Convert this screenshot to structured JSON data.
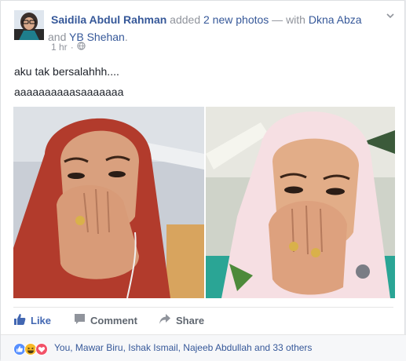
{
  "post": {
    "author": "Saidila Abdul Rahman",
    "added_text": " added ",
    "photos_link": "2 new photos",
    "with_text": " — with ",
    "tag1": "Dkna Abza",
    "and_text": " and ",
    "tag2": "YB Shehan",
    "period": ".",
    "time": "1 hr",
    "dot": "·",
    "privacy_icon": "globe-icon",
    "line1": "aku tak bersalahhh....",
    "line2": "aaaaaaaaaasaaaaaaa"
  },
  "actions": {
    "like": "Like",
    "comment": "Comment",
    "share": "Share"
  },
  "reactions": {
    "icons": [
      "like-reaction-icon",
      "haha-reaction-icon",
      "love-reaction-icon"
    ],
    "summary": "You, Mawar Biru, Ishak Ismail, Najeeb Abdullah and 33 others"
  },
  "colors": {
    "link": "#365899",
    "muted": "#90949c",
    "text": "#1d2129",
    "action": "#606770",
    "like_blue": "#5890ff",
    "love_red": "#f25268",
    "haha_yellow": "#f7b928"
  }
}
